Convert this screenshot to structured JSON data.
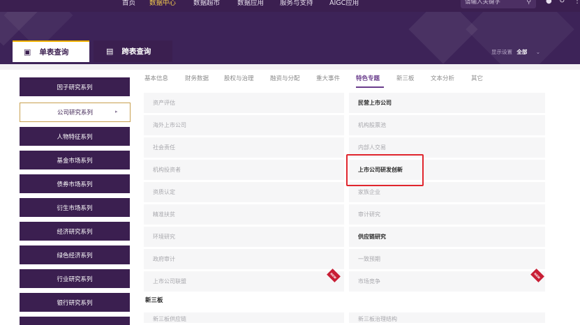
{
  "top_nav": {
    "items": [
      "首页",
      "数据中心",
      "数据超市",
      "数据应用",
      "服务与支持",
      "AIGC应用"
    ],
    "active_index": 1,
    "search_placeholder": "请输入关键字"
  },
  "tabs": {
    "single": "单表查询",
    "cross": "跨表查询"
  },
  "display_setting": {
    "label": "显示设置",
    "value": "全部"
  },
  "sidebar": {
    "items": [
      "因子研究系列",
      "公司研究系列",
      "人物特征系列",
      "基金市场系列",
      "债券市场系列",
      "衍生市场系列",
      "经济研究系列",
      "绿色经济系列",
      "行业研究系列",
      "银行研究系列"
    ],
    "active_index": 1
  },
  "category_tabs": {
    "items": [
      "基本信息",
      "财务数据",
      "股权与治理",
      "融资与分配",
      "重大事件",
      "特色专题",
      "新三板",
      "文本分析",
      "其它"
    ],
    "active_index": 5
  },
  "grid": {
    "left": [
      {
        "label": "资产评估",
        "bold": false
      },
      {
        "label": "海外上市公司",
        "bold": false
      },
      {
        "label": "社会责任",
        "bold": false
      },
      {
        "label": "机构投资者",
        "bold": false
      },
      {
        "label": "资质认定",
        "bold": false
      },
      {
        "label": "精准扶贫",
        "bold": false
      },
      {
        "label": "环境研究",
        "bold": false
      },
      {
        "label": "政府审计",
        "bold": false
      },
      {
        "label": "上市公司联盟",
        "bold": false,
        "new": true
      }
    ],
    "right": [
      {
        "label": "民营上市公司",
        "bold": true
      },
      {
        "label": "机构股票池",
        "bold": false
      },
      {
        "label": "内部人交易",
        "bold": false
      },
      {
        "label": "上市公司研发创新",
        "bold": true,
        "highlighted": true
      },
      {
        "label": "家族企业",
        "bold": false
      },
      {
        "label": "审计研究",
        "bold": false
      },
      {
        "label": "供应链研究",
        "bold": true
      },
      {
        "label": "一致预期",
        "bold": false
      },
      {
        "label": "市场竞争",
        "bold": false,
        "new": true
      }
    ],
    "new_tag_text": "NEW"
  },
  "section_xinsanban": {
    "title": "新三板",
    "left": "新三板供应链",
    "right": "新三板治理结构"
  },
  "colors": {
    "primary_purple": "#3b1f50",
    "accent_gold": "#f0b100",
    "highlight_red": "#e0262e",
    "active_tab_purple": "#6a3d8c"
  }
}
